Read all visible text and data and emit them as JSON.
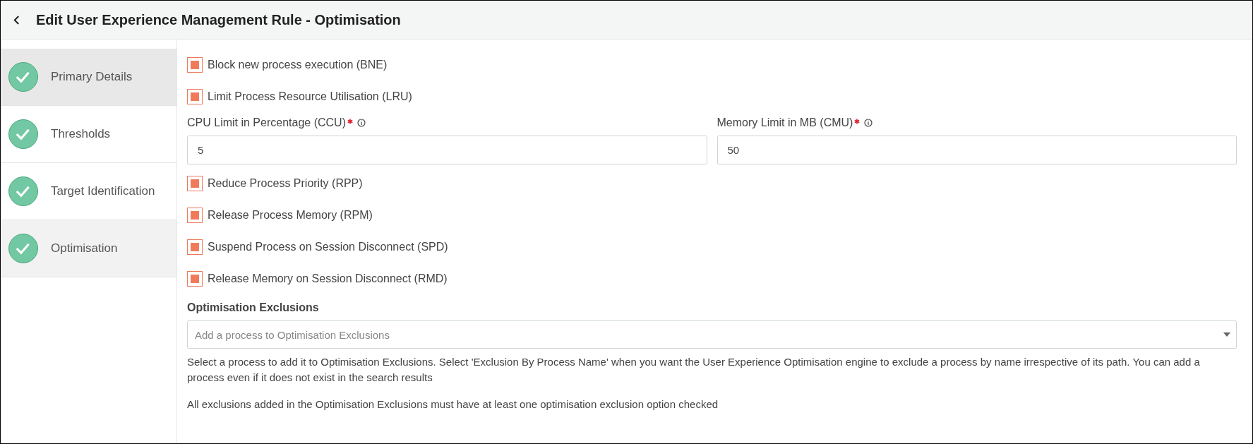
{
  "header": {
    "title": "Edit User Experience Management Rule - Optimisation"
  },
  "steps": [
    {
      "label": "Primary Details",
      "completed": true,
      "hovered": true,
      "selected": false
    },
    {
      "label": "Thresholds",
      "completed": true,
      "hovered": false,
      "selected": false
    },
    {
      "label": "Target Identification",
      "completed": true,
      "hovered": false,
      "selected": false
    },
    {
      "label": "Optimisation",
      "completed": true,
      "hovered": false,
      "selected": true
    }
  ],
  "form": [
    {
      "kind": "checkbox",
      "label": "Block new process execution (BNE)",
      "checked": true
    },
    {
      "kind": "checkbox",
      "label": "Limit Process Resource Utilisation (LRU)",
      "checked": true
    },
    {
      "kind": "fields",
      "fields": [
        {
          "label": "CPU Limit in Percentage (CCU)",
          "required": true,
          "value": "5"
        },
        {
          "label": "Memory Limit in MB (CMU)",
          "required": true,
          "value": "50"
        }
      ]
    },
    {
      "kind": "checkbox",
      "label": "Reduce Process Priority (RPP)",
      "checked": true
    },
    {
      "kind": "checkbox",
      "label": "Release Process Memory (RPM)",
      "checked": true
    },
    {
      "kind": "checkbox",
      "label": "Suspend Process on Session Disconnect (SPD)",
      "checked": true
    },
    {
      "kind": "checkbox",
      "label": "Release Memory on Session Disconnect (RMD)",
      "checked": true
    }
  ],
  "exclusions": {
    "title": "Optimisation Exclusions",
    "placeholder": "Add a process to Optimisation Exclusions",
    "help": "Select a process to add it to Optimisation Exclusions. Select 'Exclusion By Process Name' when you want the User Experience Optimisation engine to exclude a process by name irrespective of its path. You can add a process even if it does not exist in the search results",
    "note": "All exclusions added in the Optimisation Exclusions must have at least one optimisation exclusion option checked"
  }
}
